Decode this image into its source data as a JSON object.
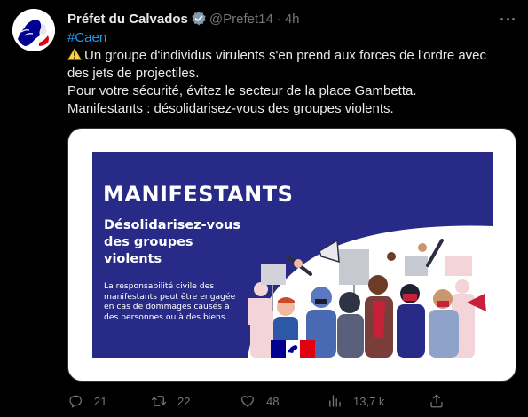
{
  "tweet": {
    "author_name": "Préfet du Calvados",
    "author_handle": "@Prefet14",
    "separator": "·",
    "time": "4h",
    "hashtag": "#Caen",
    "line1": "Un groupe d'individus virulents s'en prend aux forces de l'ordre avec des jets de projectiles.",
    "line2": "Pour votre sécurité, évitez le secteur de la place Gambetta.",
    "line3": "Manifestants : désolidarisez-vous des groupes violents."
  },
  "media": {
    "title": "MANIFESTANTS",
    "subtitle": "Désolidarisez-vous des groupes violents",
    "note": "La responsabilité civile des manifestants peut être engagée en cas de dommages causés à des personnes ou à des biens."
  },
  "actions": {
    "replies": "21",
    "retweets": "22",
    "likes": "48",
    "views": "13,7 k"
  },
  "icons": {
    "verified": "verified-badge-icon",
    "warning": "warning-icon",
    "more": "more-icon",
    "reply": "reply-icon",
    "retweet": "retweet-icon",
    "like": "like-icon",
    "views": "views-icon",
    "share": "share-icon"
  },
  "colors": {
    "background": "#000000",
    "text": "#e7e9ea",
    "secondary": "#71767b",
    "link": "#1d9bf0",
    "poster_blue": "#272a86",
    "flag_blue": "#000091",
    "flag_red": "#e1000f"
  }
}
